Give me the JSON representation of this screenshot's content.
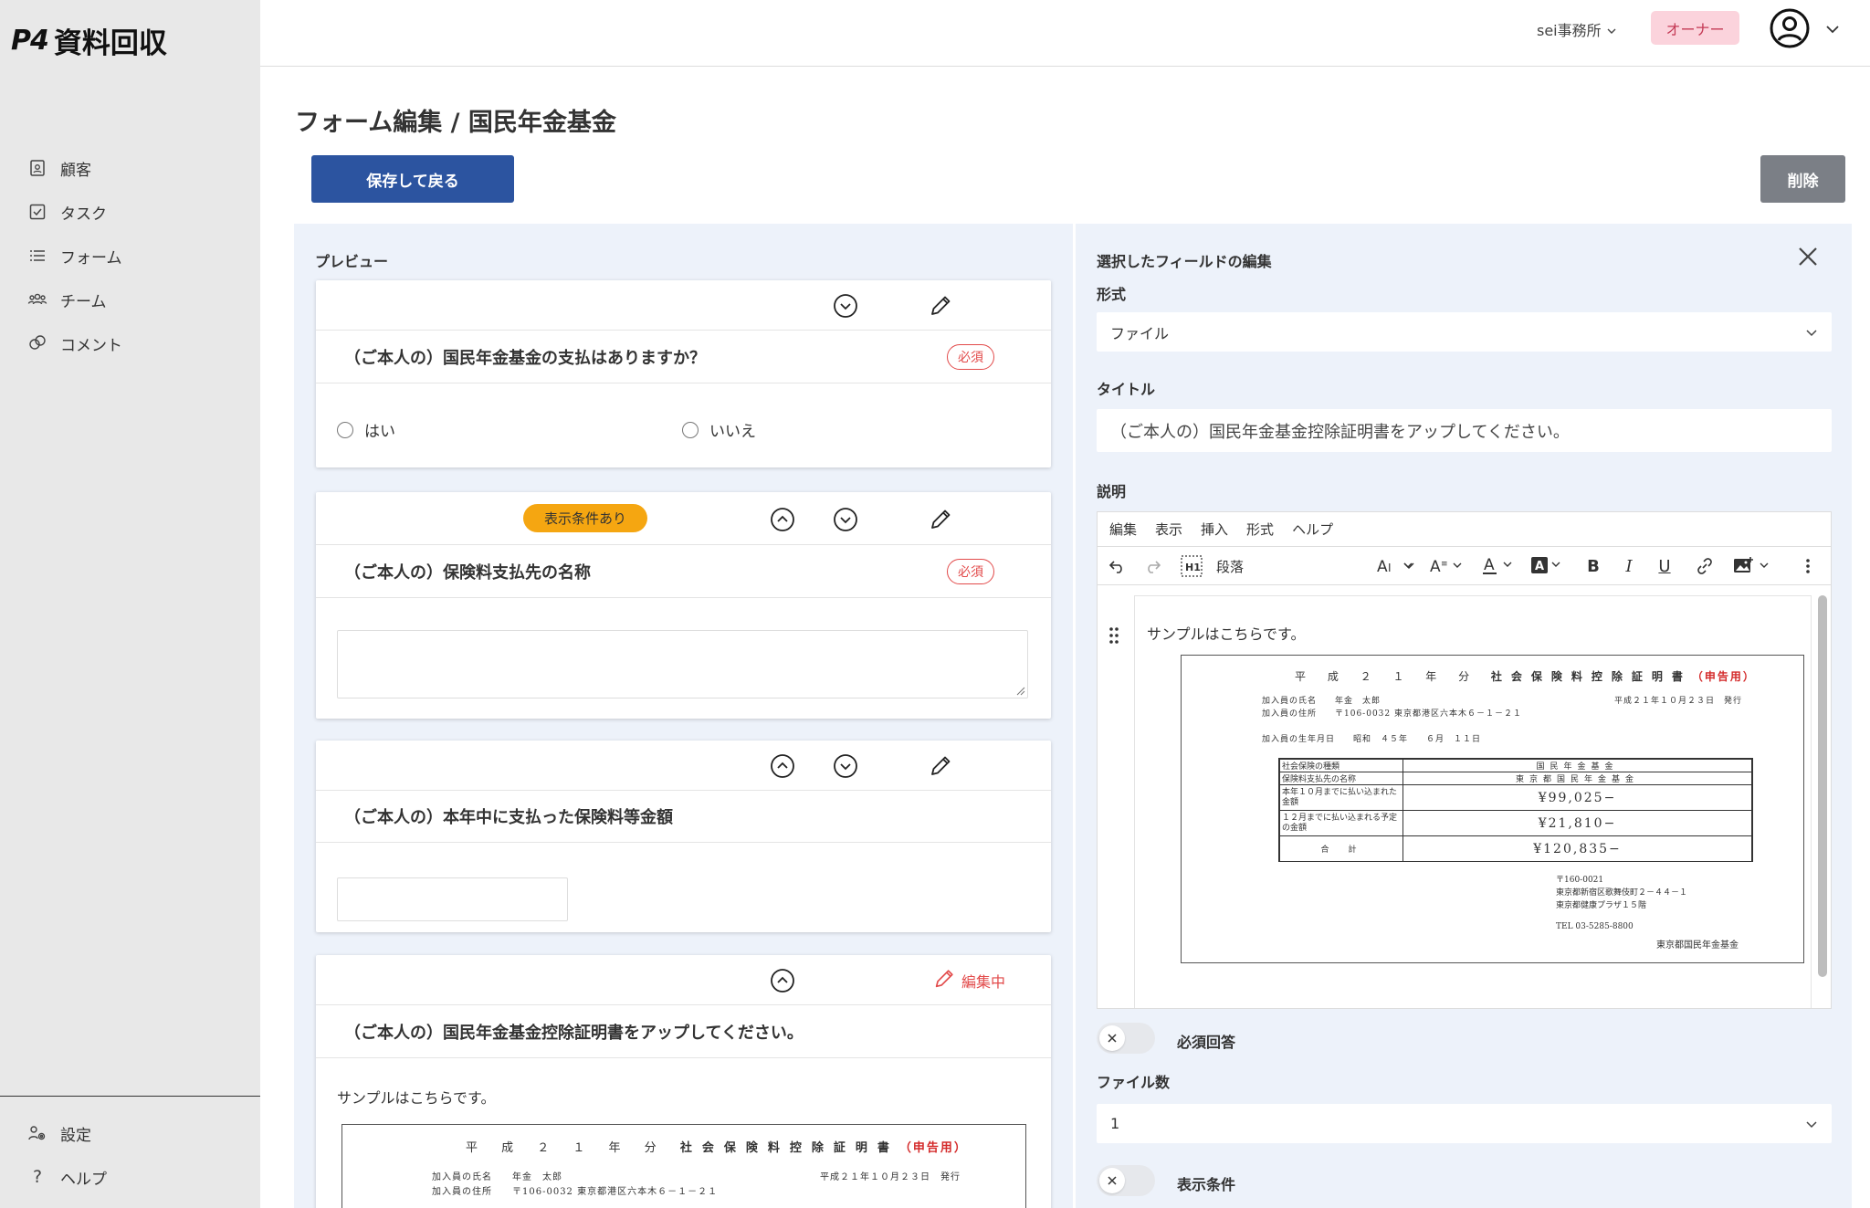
{
  "app": {
    "logo_mark": "P4",
    "logo_text": "資料回収"
  },
  "sidebar": {
    "items": [
      {
        "label": "顧客",
        "icon": "customer-icon"
      },
      {
        "label": "タスク",
        "icon": "task-checkbox-icon"
      },
      {
        "label": "フォーム",
        "icon": "list-icon"
      },
      {
        "label": "チーム",
        "icon": "team-icon"
      },
      {
        "label": "コメント",
        "icon": "comment-icon"
      }
    ],
    "bottom_items": [
      {
        "label": "設定",
        "icon": "settings-icon"
      },
      {
        "label": "ヘルプ",
        "icon": "help-icon"
      }
    ]
  },
  "header": {
    "office": "sei事務所",
    "role": "オーナー"
  },
  "page": {
    "title": "フォーム編集 / 国民年金基金",
    "save_button": "保存して戻る",
    "delete_button": "削除"
  },
  "preview": {
    "label": "プレビュー",
    "required_label": "必須",
    "condition_badge": "表示条件あり",
    "editing_label": "編集中",
    "q1": {
      "text": "（ご本人の）国民年金基金の支払はありますか？",
      "options": [
        "はい",
        "いいえ"
      ]
    },
    "q2": {
      "text": "（ご本人の）保険料支払先の名称"
    },
    "q3": {
      "text": "（ご本人の）本年中に支払った保険料等金額"
    },
    "q4": {
      "text": "（ご本人の）国民年金基金控除証明書をアップしてください。",
      "description": "サンプルはこちらです。"
    }
  },
  "document": {
    "title_prefix": "平 成 ２ １ 年 分",
    "title_bold": "社会保険料控除証明書",
    "title_red": "（申告用）",
    "name_line": "加入員の氏名　　年金　太郎",
    "address_line": "加入員の住所　　〒106-0032 東京都港区六本木６－１－２１",
    "issue_date": "平成２１年１０月２３日　発行",
    "birth_line": "加入員の生年月日　　昭和　４５年　　６月　１１日",
    "rows": [
      {
        "label": "社会保険の種類",
        "value": "国民年金基金"
      },
      {
        "label": "保険料支払先の名称",
        "value": "東京都国民年金基金"
      },
      {
        "label": "本年１０月までに払い込まれた金額",
        "value": "¥99,025−"
      },
      {
        "label": "１２月までに払い込まれる予定の金額",
        "value": "¥21,810−"
      },
      {
        "label": "合　計",
        "value": "¥120,835−"
      }
    ],
    "addr1": "〒160-0021",
    "addr2": "東京都新宿区歌舞伎町２－４４－１",
    "addr3": "東京都健康プラザ１５階",
    "tel": "TEL 03-5285-8800",
    "org": "東京都国民年金基金"
  },
  "edit": {
    "title": "選択したフィールドの編集",
    "format_label": "形式",
    "format_value": "ファイル",
    "title_label": "タイトル",
    "title_value": "（ご本人の）国民年金基金控除証明書をアップしてください。",
    "desc_label": "説明",
    "menu": [
      "編集",
      "表示",
      "挿入",
      "形式",
      "ヘルプ"
    ],
    "paragraph_select": "段落",
    "body_text": "サンプルはこちらです。",
    "required_toggle": "必須回答",
    "file_count_label": "ファイル数",
    "file_count_value": "1",
    "condition_toggle": "表示条件"
  },
  "colors": {
    "primary": "#2c54a0",
    "required": "#e24a4a",
    "condition": "#f5a611",
    "panel_bg": "#edf2fa"
  }
}
